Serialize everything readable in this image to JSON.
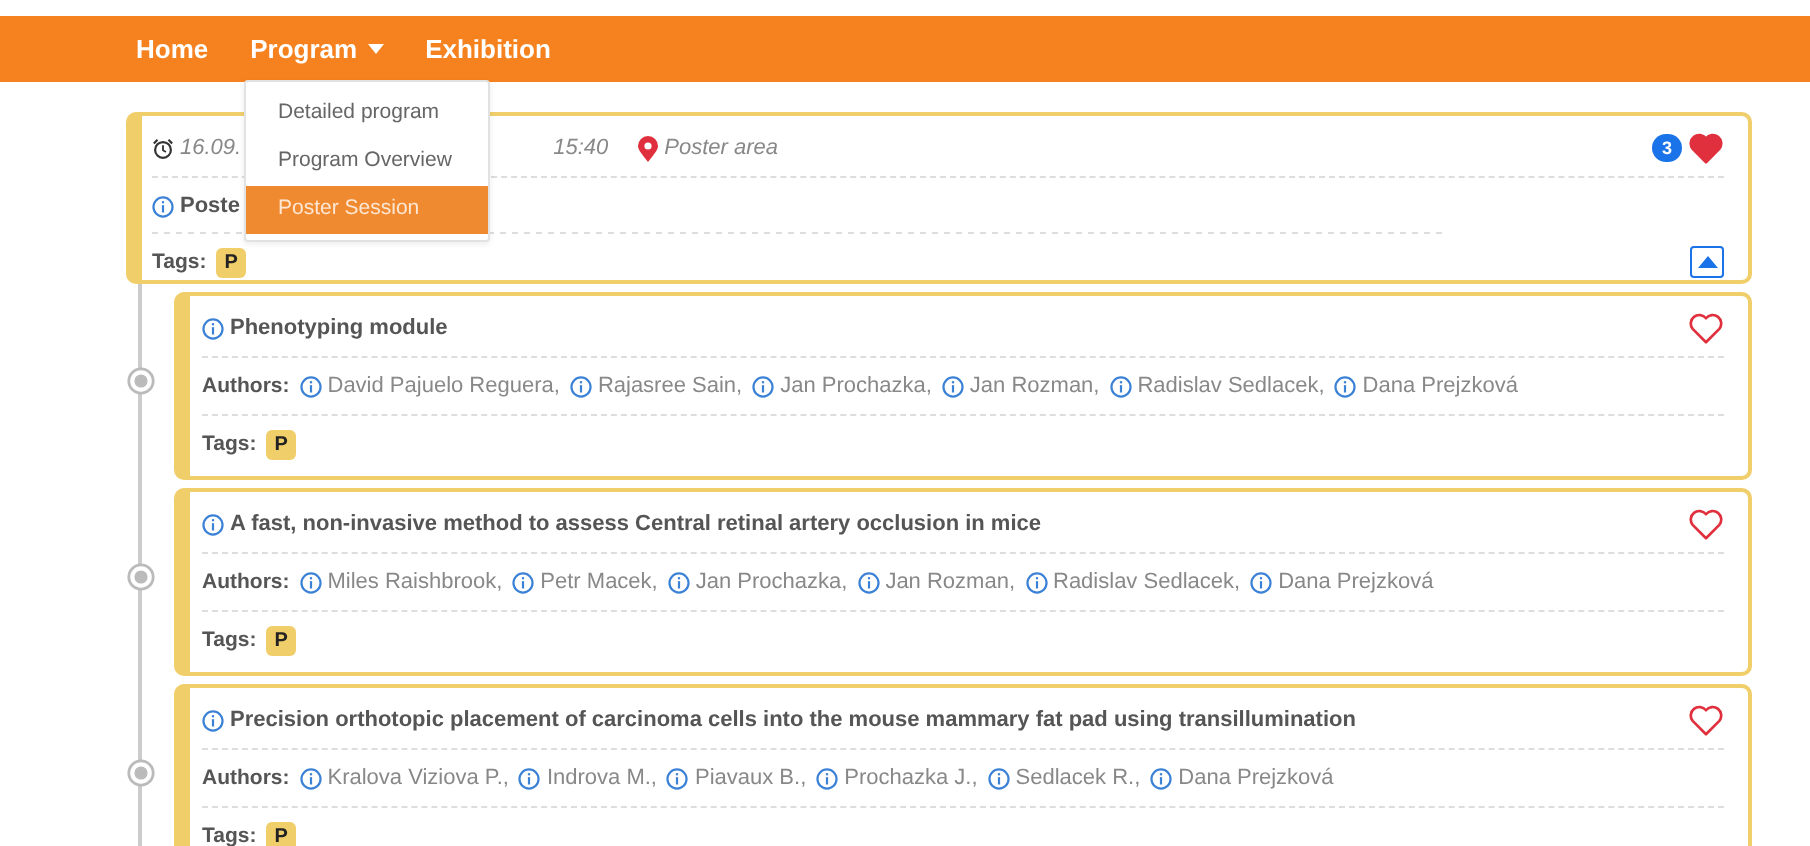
{
  "nav": {
    "items": [
      {
        "label": "Home",
        "dropdown": false
      },
      {
        "label": "Program",
        "dropdown": true
      },
      {
        "label": "Exhibition",
        "dropdown": false
      }
    ],
    "menu": [
      {
        "label": "Detailed program",
        "selected": false
      },
      {
        "label": "Program Overview",
        "selected": false
      },
      {
        "label": "Poster Session",
        "selected": true
      }
    ]
  },
  "session": {
    "time_start": "16.09.",
    "time_end": "15:40",
    "location": "Poster area",
    "favorites_count": "3",
    "favorite": true,
    "title": "Poste",
    "tags_label": "Tags:",
    "tags": [
      "P"
    ],
    "expanded": true
  },
  "papers": [
    {
      "title": "Phenotyping module",
      "favorite": false,
      "authors_label": "Authors:",
      "authors": [
        "David Pajuelo Reguera,",
        "Rajasree Sain,",
        "Jan Prochazka,",
        "Jan Rozman,",
        "Radislav Sedlacek,",
        "Dana Prejzková"
      ],
      "tags_label": "Tags:",
      "tags": [
        "P"
      ]
    },
    {
      "title": "A fast, non-invasive method to assess Central retinal artery occlusion in mice",
      "favorite": false,
      "authors_label": "Authors:",
      "authors": [
        "Miles Raishbrook,",
        "Petr Macek,",
        "Jan Prochazka,",
        "Jan Rozman,",
        "Radislav Sedlacek,",
        "Dana Prejzková"
      ],
      "tags_label": "Tags:",
      "tags": [
        "P"
      ]
    },
    {
      "title": "Precision orthotopic placement of carcinoma cells into the mouse mammary fat pad using transillumination",
      "favorite": false,
      "authors_label": "Authors:",
      "authors": [
        "Kralova Viziova P.,",
        "Indrova M.,",
        "Piavaux B.,",
        "Prochazka J.,",
        "Sedlacek R.,",
        "Dana Prejzková"
      ],
      "tags_label": "Tags:",
      "tags": [
        "P"
      ]
    }
  ]
}
